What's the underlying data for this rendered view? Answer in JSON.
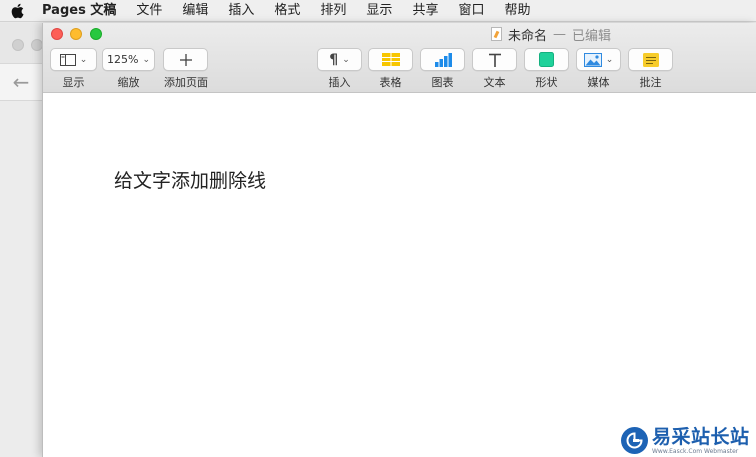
{
  "menubar": {
    "app_name": "Pages 文稿",
    "items": [
      "文件",
      "编辑",
      "插入",
      "格式",
      "排列",
      "显示",
      "共享",
      "窗口",
      "帮助"
    ]
  },
  "window": {
    "document_name": "未命名",
    "separator": "—",
    "status": "已编辑"
  },
  "toolbar": {
    "view_label": "显示",
    "zoom_value": "125%",
    "zoom_label": "缩放",
    "add_page_label": "添加页面",
    "insert_label": "插入",
    "table_label": "表格",
    "chart_label": "图表",
    "text_label": "文本",
    "shape_label": "形状",
    "media_label": "媒体",
    "comment_label": "批注",
    "icons": {
      "view": "sidebar-layout-icon",
      "add_page": "plus-icon",
      "insert": "paragraph-icon",
      "table": "table-icon",
      "chart": "bar-chart-icon",
      "text": "text-t-icon",
      "shape": "square-shape-icon",
      "media": "photo-icon",
      "comment": "note-icon"
    },
    "accent_colors": {
      "table": "#f7c600",
      "chart": "#1d8be9",
      "shape": "#1fd19a",
      "comment": "#f7cc2a"
    }
  },
  "document": {
    "body_text": "给文字添加删除线"
  },
  "watermark": {
    "name": "易采站长站",
    "sub": "Www.Easck.Com Webmaster"
  }
}
